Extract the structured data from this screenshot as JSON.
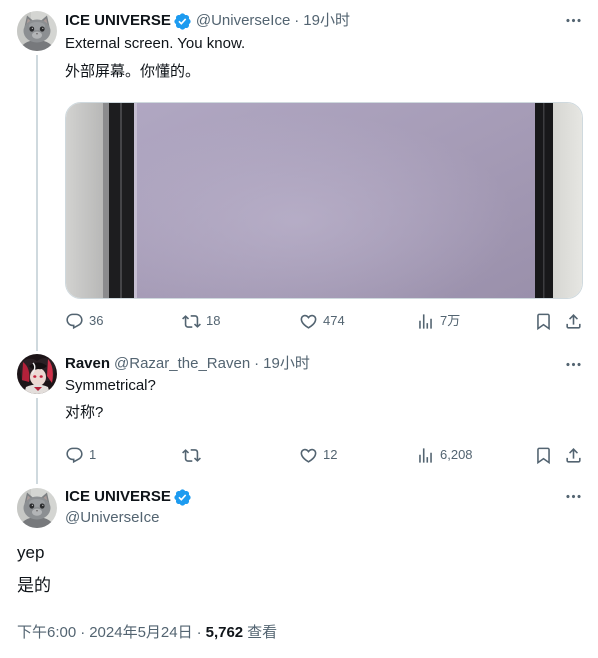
{
  "colors": {
    "background": "#ffffff",
    "text_primary": "#0f1419",
    "text_secondary": "#536471",
    "verified_badge": "#1d9bf0",
    "thread_line": "#cfd9de"
  },
  "thread": [
    {
      "author": {
        "name": "ICE UNIVERSE",
        "handle": "@UniverseIce",
        "verified": true,
        "avatar_icon": "cat-avatar-icon"
      },
      "separator": "·",
      "time": "19小时",
      "text": "External screen. You know.",
      "translated_text": "外部屏幕。你懂的。",
      "actions": {
        "reply": {
          "icon": "reply-icon",
          "count": "36"
        },
        "retweet": {
          "icon": "retweet-icon",
          "count": "18"
        },
        "like": {
          "icon": "like-icon",
          "count": "474"
        },
        "views": {
          "icon": "views-icon",
          "count": "7万"
        },
        "bookmark": {
          "icon": "bookmark-icon"
        },
        "share": {
          "icon": "share-icon"
        }
      }
    },
    {
      "author": {
        "name": "Raven",
        "handle": "@Razar_the_Raven",
        "verified": false,
        "avatar_icon": "anime-avatar-icon"
      },
      "separator": "·",
      "time": "19小时",
      "text": "Symmetrical?",
      "translated_text": "对称?",
      "actions": {
        "reply": {
          "icon": "reply-icon",
          "count": "1"
        },
        "retweet": {
          "icon": "retweet-icon"
        },
        "like": {
          "icon": "like-icon",
          "count": "12"
        },
        "views": {
          "icon": "views-icon",
          "count": "6,208"
        },
        "bookmark": {
          "icon": "bookmark-icon"
        },
        "share": {
          "icon": "share-icon"
        }
      }
    }
  ],
  "focused_tweet": {
    "author": {
      "name": "ICE UNIVERSE",
      "handle": "@UniverseIce",
      "verified": true,
      "avatar_icon": "cat-avatar-icon"
    },
    "text": "yep",
    "translated_text": "是的",
    "time": "下午6:00",
    "separator": "·",
    "date": "2024年5月24日",
    "views_count": "5,762",
    "views_label": "查看"
  }
}
